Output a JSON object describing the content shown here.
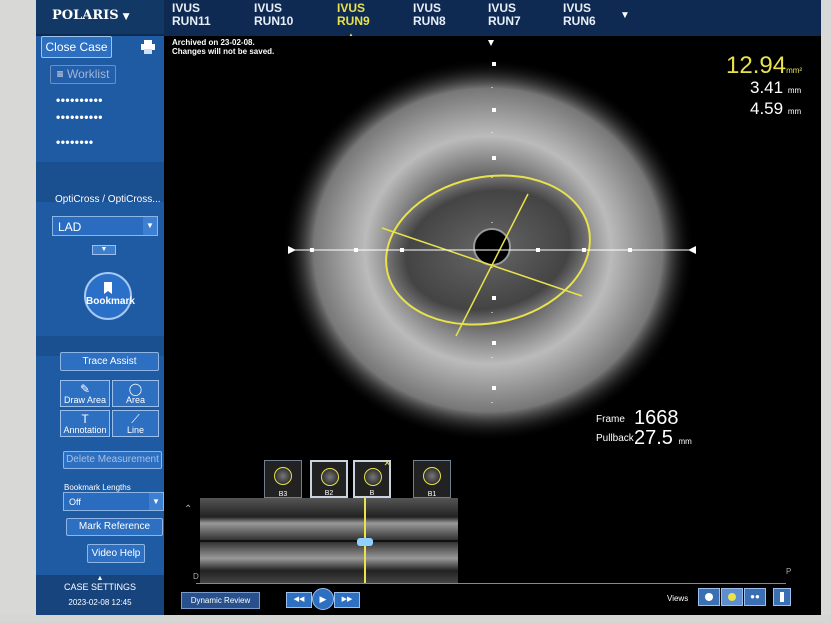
{
  "brand": {
    "name": "POLARIS",
    "caret": "▼"
  },
  "runs": [
    {
      "line1": "IVUS",
      "line2": "RUN11",
      "active": false
    },
    {
      "line1": "IVUS",
      "line2": "RUN10",
      "active": false
    },
    {
      "line1": "IVUS",
      "line2": "RUN9",
      "active": true
    },
    {
      "line1": "IVUS",
      "line2": "RUN8",
      "active": false
    },
    {
      "line1": "IVUS",
      "line2": "RUN7",
      "active": false
    },
    {
      "line1": "IVUS",
      "line2": "RUN6",
      "active": false
    }
  ],
  "runs_more": "▼",
  "sidebar": {
    "close_case": "Close Case",
    "worklist": "Worklist",
    "masked1": "••••••••••",
    "masked2": "••••••••••",
    "masked3": "••••••••",
    "catheter": "OptiCross / OptiCross...",
    "vessel": "LAD",
    "bookmark": "Bookmark",
    "trace_assist": "Trace Assist",
    "draw_area": "Draw Area",
    "area": "Area",
    "annotation": "Annotation",
    "line": "Line",
    "delete_measurement": "Delete Measurement",
    "bookmark_lengths_label": "Bookmark Lengths",
    "bookmark_lengths_value": "Off",
    "mark_reference": "Mark Reference",
    "video_help": "Video Help",
    "case_settings": "CASE SETTINGS",
    "datetime": "2023-02-08 12:45"
  },
  "archived": {
    "line1": "Archived on 23-02-08.",
    "line2": "Changes will not be saved."
  },
  "measurements": {
    "area_value": "12.94",
    "area_unit": "mm²",
    "d1_value": "3.41",
    "d1_unit": "mm",
    "d2_value": "4.59",
    "d2_unit": "mm"
  },
  "frame": {
    "frame_label": "Frame",
    "frame_value": "1668",
    "pullback_label": "Pullback",
    "pullback_value": "27.5",
    "pullback_unit": "mm"
  },
  "thumbnails": [
    {
      "label": "B3",
      "selected": false
    },
    {
      "label": "B2",
      "selected": true
    },
    {
      "label": "B",
      "selected": true
    },
    {
      "label": "B1",
      "selected": false
    }
  ],
  "longview": {
    "left_label": "D",
    "right_label": "P"
  },
  "controls": {
    "dynamic_review": "Dynamic Review",
    "rewind": "◀◀",
    "play": "▶",
    "forward": "▶▶",
    "views": "Views"
  },
  "colors": {
    "accent": "#e9e24a",
    "sidebar": "#1e5ba3",
    "topbar": "#0e2a52"
  }
}
